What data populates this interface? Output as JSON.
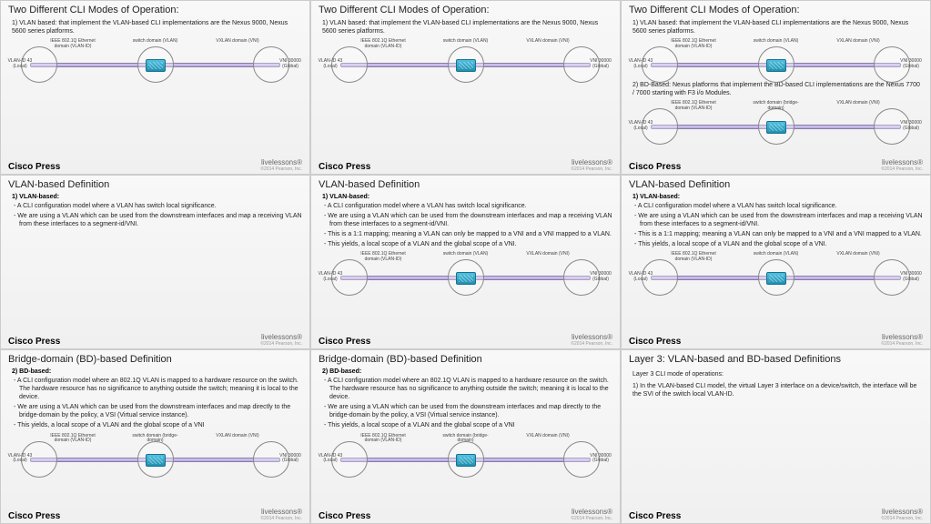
{
  "footer": {
    "press": "Cisco Press",
    "live": "livelessons®",
    "copy": "©2014 Pearson, Inc."
  },
  "diag": {
    "topleft": "IEEE 802.1Q Ethernet domain (VLAN-ID)",
    "topmid_switch": "switch domain (VLAN)",
    "topmid_bridge": "switch domain (bridge-domain)",
    "topright": "VXLAN domain (VNI)",
    "botleft": "VLAN-ID 43 (Local)",
    "botright": "VNI 30000 (Global)"
  },
  "p1": {
    "title": "Two Different CLI Modes of Operation:",
    "i1": "1)  VLAN based: that implement the VLAN-based CLI implementations are the Nexus 9000, Nexus 5600 series platforms."
  },
  "p3": {
    "i2": "2)  BD-Based: Nexus platforms that implement the BD-based CLI implementations are the Nexus 7700 / 7000 starting with F3 i/o Modules."
  },
  "p4": {
    "title": "VLAN-based Definition",
    "h1": "1)  VLAN-based:",
    "b1": "A CLI configuration model where a VLAN has switch local significance.",
    "b2": "We are using a VLAN which can be used from the downstream interfaces and map a receiving VLAN from these interfaces to a segment-id/VNI.",
    "b3": "This is a 1:1 mapping; meaning a VLAN can only be mapped to a VNI and a VNI mapped to a VLAN.",
    "b4": "This yields, a local scope of a VLAN and the global scope of a VNI."
  },
  "p7": {
    "title": "Bridge-domain (BD)-based Definition",
    "h1": "2) BD-based:",
    "b1": "A CLI configuration model where an 802.1Q VLAN is mapped to a hardware resource on the switch.  The hardware resource has no significance to anything outside the switch; meaning it is local to the device.",
    "b2": "We are using a VLAN which can be used from the downstream interfaces and map directly to the bridge-domain by the policy, a VSI (Virtual service instance).",
    "b3": "This yields, a local scope of a VLAN and the global scope of a VNI"
  },
  "p9": {
    "title": "Layer 3: VLAN-based and BD-based Definitions",
    "h1": "Layer 3 CLI mode of operations:",
    "i1": "1) In the VLAN-based CLI model, the virtual Layer 3 interface on a device/switch, the interface will be the SVI of the switch local VLAN-ID."
  }
}
